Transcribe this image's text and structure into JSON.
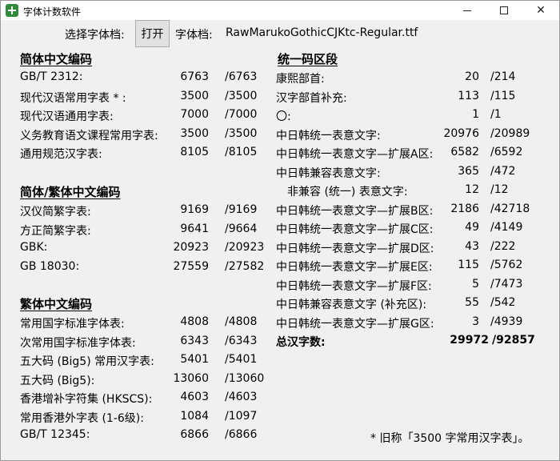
{
  "window": {
    "title": "字体计数软件",
    "minimize_label": "—",
    "close_label": "✕"
  },
  "toolbar": {
    "select_label": "选择字体档:",
    "open_button": "打开",
    "font_label": "字体档:",
    "font_name": "RawMarukoGothicCJKtc-Regular.ttf"
  },
  "left": {
    "sections": [
      {
        "title": "简体中文编码",
        "rows": [
          {
            "label": "GB/T 2312:",
            "count": "6763",
            "total": "/6763"
          },
          {
            "label": "现代汉语常用字表 * :",
            "count": "3500",
            "total": "/3500"
          },
          {
            "label": "现代汉语通用字表:",
            "count": "7000",
            "total": "/7000"
          },
          {
            "label": "义务教育语文课程常用字表:",
            "count": "3500",
            "total": "/3500"
          },
          {
            "label": "通用规范汉字表:",
            "count": "8105",
            "total": "/8105"
          }
        ]
      },
      {
        "title": "简体/繁体中文编码",
        "rows": [
          {
            "label": "汉仪简繁字表:",
            "count": "9169",
            "total": "/9169"
          },
          {
            "label": "方正简繁字表:",
            "count": "9641",
            "total": "/9664"
          },
          {
            "label": "GBK:",
            "count": "20923",
            "total": "/20923"
          },
          {
            "label": "GB 18030:",
            "count": "27559",
            "total": "/27582"
          }
        ]
      },
      {
        "title": "繁体中文编码",
        "rows": [
          {
            "label": "常用国字标准字体表:",
            "count": "4808",
            "total": "/4808"
          },
          {
            "label": "次常用国字标准字体表:",
            "count": "6343",
            "total": "/6343"
          },
          {
            "label": "五大码 (Big5) 常用汉字表:",
            "count": "5401",
            "total": "/5401"
          },
          {
            "label": "五大码 (Big5):",
            "count": "13060",
            "total": "/13060"
          },
          {
            "label": "香港增补字符集 (HKSCS):",
            "count": "4603",
            "total": "/4603"
          },
          {
            "label": "常用香港外字表 (1-6级):",
            "count": "1084",
            "total": "/1097"
          },
          {
            "label": "GB/T 12345:",
            "count": "6866",
            "total": "/6866"
          }
        ]
      }
    ]
  },
  "right": {
    "title": "统一码区段",
    "rows": [
      {
        "label": "康熙部首:",
        "count": "20",
        "total": "/214"
      },
      {
        "label": "汉字部首补充:",
        "count": "113",
        "total": "/115"
      },
      {
        "label": "〇:",
        "count": "1",
        "total": "/1"
      },
      {
        "label": "中日韩统一表意文字:",
        "count": "20976",
        "total": "/20989"
      },
      {
        "label": "中日韩统一表意文字—扩展A区:",
        "count": "6582",
        "total": "/6592"
      },
      {
        "label": "中日韩兼容表意文字:",
        "count": "365",
        "total": "/472"
      },
      {
        "label": "非兼容 (统一) 表意文字:",
        "count": "12",
        "total": "/12"
      },
      {
        "label": "中日韩统一表意文字—扩展B区:",
        "count": "2186",
        "total": "/42718"
      },
      {
        "label": "中日韩统一表意文字—扩展C区:",
        "count": "49",
        "total": "/4149"
      },
      {
        "label": "中日韩统一表意文字—扩展D区:",
        "count": "43",
        "total": "/222"
      },
      {
        "label": "中日韩统一表意文字—扩展E区:",
        "count": "115",
        "total": "/5762"
      },
      {
        "label": "中日韩统一表意文字—扩展F区:",
        "count": "5",
        "total": "/7473"
      },
      {
        "label": "中日韩兼容表意文字 (补充区):",
        "count": "55",
        "total": "/542"
      },
      {
        "label": "中日韩统一表意文字—扩展G区:",
        "count": "3",
        "total": "/4939"
      }
    ],
    "total": {
      "label": "总汉字数:",
      "count": "29972",
      "total": "/92857"
    }
  },
  "note": "* 旧称「3500 字常用汉字表」。"
}
